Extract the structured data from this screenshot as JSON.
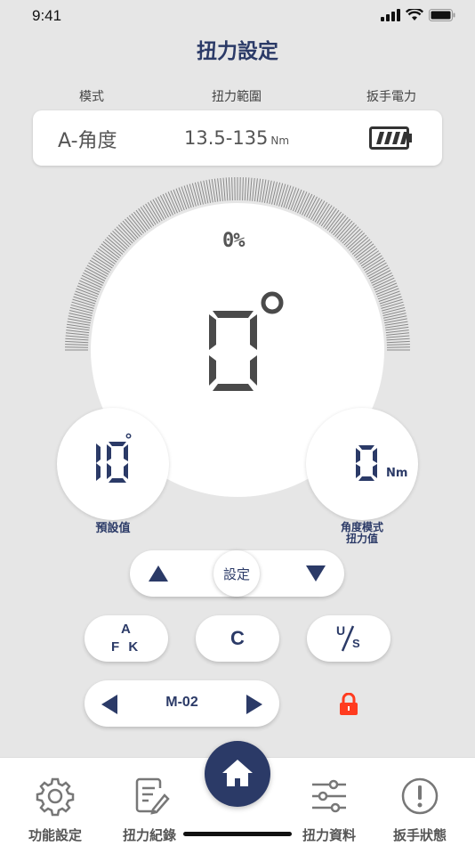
{
  "status": {
    "time": "9:41"
  },
  "header": {
    "title": "扭力設定"
  },
  "info": {
    "mode_label": "模式",
    "range_label": "扭力範圍",
    "battery_label": "扳手電力",
    "mode_value": "A-角度",
    "range_value": "13.5-135",
    "range_unit": "Nm",
    "battery_level": 1.0
  },
  "gauge": {
    "percent": "0%",
    "angle_value": "0",
    "degree_symbol": "°",
    "progress": 0
  },
  "preset": {
    "value": "10",
    "unit": "°",
    "label": "預設值"
  },
  "angle_torque": {
    "value": "0",
    "unit": "Nm",
    "label_line1": "角度模式",
    "label_line2": "扭力值"
  },
  "controls": {
    "set_label": "設定",
    "afk_top": "A",
    "afk_bottom": "F K",
    "clear_label": "C",
    "us_top": "U",
    "us_bottom": "S",
    "memory_label": "M-02"
  },
  "tabs": [
    {
      "label": "功能設定",
      "icon": "gear-icon"
    },
    {
      "label": "扭力紀錄",
      "icon": "document-edit-icon"
    },
    {
      "label": "",
      "icon": "home-icon"
    },
    {
      "label": "扭力資料",
      "icon": "sliders-icon"
    },
    {
      "label": "扳手狀態",
      "icon": "alert-circle-icon"
    }
  ],
  "colors": {
    "navy": "#2b3a67",
    "lock": "#ff3b1f",
    "background": "#e6e6e6"
  }
}
